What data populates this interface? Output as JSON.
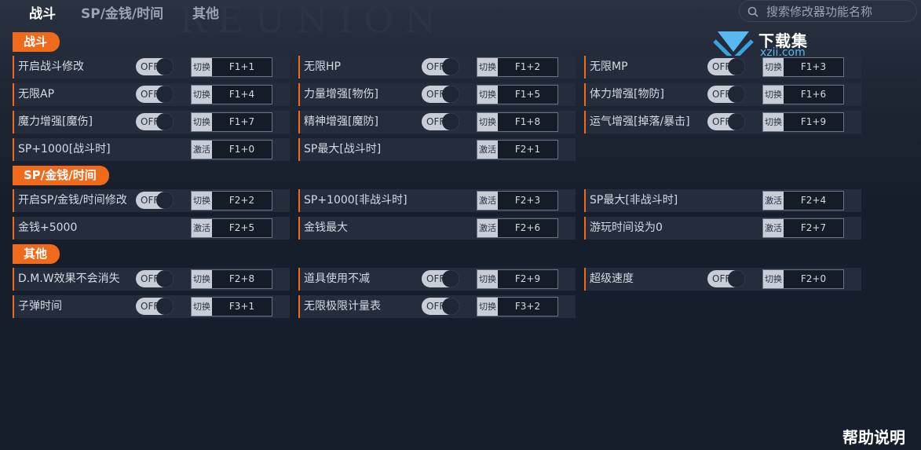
{
  "nav": {
    "tabs": [
      {
        "label": "战斗",
        "active": true
      },
      {
        "label": "SP/金钱/时间",
        "active": false
      },
      {
        "label": "其他",
        "active": false
      }
    ]
  },
  "search": {
    "placeholder": "搜索修改器功能名称",
    "value": ""
  },
  "background_title": "REUNION",
  "watermark": {
    "zh": "下载集",
    "en": "xzji.com"
  },
  "colors": {
    "accent": "#ef6a1a",
    "background": "#161d2b",
    "row": "#252c3b",
    "logo_blue": "#5ab8f0"
  },
  "sections": [
    {
      "title": "战斗",
      "items": [
        {
          "label": "开启战斗修改",
          "toggle": "OFF",
          "action": "切换",
          "hotkey": "F1+1"
        },
        {
          "label": "无限HP",
          "toggle": "OFF",
          "action": "切换",
          "hotkey": "F1+2"
        },
        {
          "label": "无限MP",
          "toggle": "OFF",
          "action": "切换",
          "hotkey": "F1+3"
        },
        {
          "label": "无限AP",
          "toggle": "OFF",
          "action": "切换",
          "hotkey": "F1+4"
        },
        {
          "label": "力量增强[物伤]",
          "toggle": "OFF",
          "action": "切换",
          "hotkey": "F1+5"
        },
        {
          "label": "体力增强[物防]",
          "toggle": "OFF",
          "action": "切换",
          "hotkey": "F1+6"
        },
        {
          "label": "魔力增强[魔伤]",
          "toggle": "OFF",
          "action": "切换",
          "hotkey": "F1+7"
        },
        {
          "label": "精神增强[魔防]",
          "toggle": "OFF",
          "action": "切换",
          "hotkey": "F1+8"
        },
        {
          "label": "运气增强[掉落/暴击]",
          "toggle": "OFF",
          "action": "切换",
          "hotkey": "F1+9"
        },
        {
          "label": "SP+1000[战斗时]",
          "toggle": null,
          "action": "激活",
          "hotkey": "F1+0"
        },
        {
          "label": "SP最大[战斗时]",
          "toggle": null,
          "action": "激活",
          "hotkey": "F2+1"
        }
      ]
    },
    {
      "title": "SP/金钱/时间",
      "items": [
        {
          "label": "开启SP/金钱/时间修改",
          "toggle": "OFF",
          "action": "切换",
          "hotkey": "F2+2"
        },
        {
          "label": "SP+1000[非战斗时]",
          "toggle": null,
          "action": "激活",
          "hotkey": "F2+3"
        },
        {
          "label": "SP最大[非战斗时]",
          "toggle": null,
          "action": "激活",
          "hotkey": "F2+4"
        },
        {
          "label": "金钱+5000",
          "toggle": null,
          "action": "激活",
          "hotkey": "F2+5"
        },
        {
          "label": "金钱最大",
          "toggle": null,
          "action": "激活",
          "hotkey": "F2+6"
        },
        {
          "label": "游玩时间设为0",
          "toggle": null,
          "action": "激活",
          "hotkey": "F2+7"
        }
      ]
    },
    {
      "title": "其他",
      "items": [
        {
          "label": "D.M.W效果不会消失",
          "toggle": "OFF",
          "action": "切换",
          "hotkey": "F2+8"
        },
        {
          "label": "道具使用不减",
          "toggle": "OFF",
          "action": "切换",
          "hotkey": "F2+9"
        },
        {
          "label": "超级速度",
          "toggle": "OFF",
          "action": "切换",
          "hotkey": "F2+0"
        },
        {
          "label": "子弹时间",
          "toggle": "OFF",
          "action": "切换",
          "hotkey": "F3+1"
        },
        {
          "label": "无限极限计量表",
          "toggle": "OFF",
          "action": "切换",
          "hotkey": "F3+2"
        }
      ]
    }
  ],
  "help_label": "帮助说明"
}
